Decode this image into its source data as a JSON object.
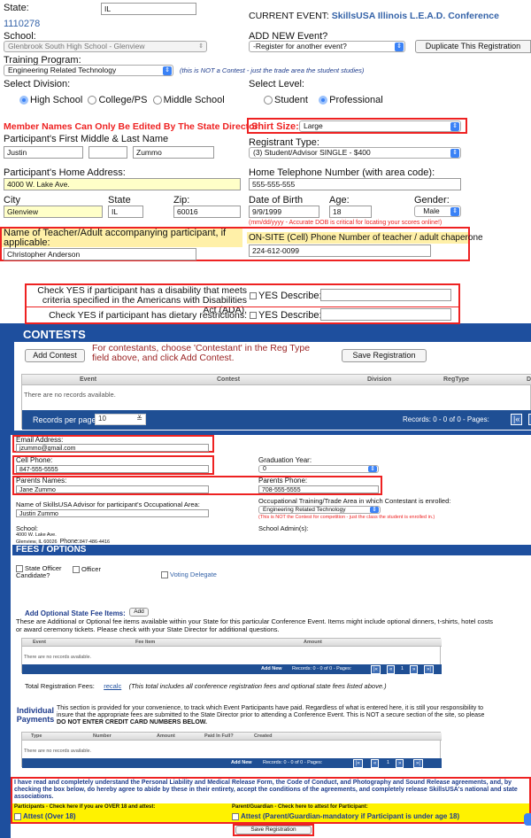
{
  "top": {
    "state_label": "State:",
    "state_value": "IL",
    "reg_id": "1110278",
    "current_event_prefix": "CURRENT EVENT:",
    "current_event_name": "SkillsUSA Illinois L.E.A.D. Conference",
    "school_label": "School:",
    "school_value": "Glenbrook South High School - Glenview",
    "add_event_label": "ADD NEW Event?",
    "add_event_value": "-Register for another event?",
    "duplicate_btn": "Duplicate This Registration",
    "program_label": "Training Program:",
    "program_value": "Engineering Related Technology",
    "program_note": "(this is NOT a Contest - just the trade area the student studies)",
    "division_label": "Select Division:",
    "divisions": [
      "High School",
      "College/PS",
      "Middle School"
    ],
    "level_label": "Select Level:",
    "levels": [
      "Student",
      "Professional"
    ]
  },
  "participant": {
    "names_warning": "Member Names Can Only Be Edited By The State Director",
    "shirt_label": "Shirt Size:",
    "shirt_value": "Large",
    "name_label": "Participant's First Middle & Last Name",
    "first_name": "Justin",
    "middle_name": "",
    "last_name": "Zummo",
    "reg_type_label": "Registrant Type:",
    "reg_type_value": "(3) Student/Advisor SINGLE - $400",
    "address_label": "Participant's Home Address:",
    "address_value": "4000 W. Lake Ave.",
    "phone_label": "Home Telephone Number (with area code):",
    "phone_value": "555-555-555",
    "city_label": "City",
    "city_value": "Glenview",
    "state_label": "State",
    "state_value": "IL",
    "zip_label": "Zip:",
    "zip_value": "60016",
    "dob_label": "Date of Birth",
    "dob_value": "9/9/1999",
    "age_label": "Age:",
    "age_value": "18",
    "gender_label": "Gender:",
    "gender_value": "Male",
    "dob_note": "(mm/dd/yyyy - Accurate DOB is critical for locating your scores online!)",
    "teacher_label": "Name of Teacher/Adult accompanying participant, if applicable:",
    "teacher_value": "Christopher Anderson",
    "onsite_label": "ON-SITE (Cell) Phone Number of teacher / adult chaperone",
    "onsite_value": "224-612-0099"
  },
  "ada": {
    "disability_label": "Check YES if participant has a disability that meets criteria specified in the Americans with Disabilities Act (ADA).",
    "diet_label": "Check YES if participant has dietary restrictions:",
    "yes_label": "YES",
    "describe_label": "Describe:"
  },
  "contests": {
    "title": "CONTESTS",
    "add_btn": "Add Contest",
    "instructions": "For contestants, choose 'Contestant' in the Reg Type field above, and click Add Contest.",
    "save_btn": "Save Registration",
    "columns": [
      "Event",
      "Contest",
      "Division",
      "RegType",
      "D"
    ],
    "empty": "There are no records available.",
    "per_page_label": "Records per page:",
    "per_page_value": "10",
    "records": "Records: 0 - 0 of 0 - Pages:"
  },
  "contact": {
    "email_label": "Email Address:",
    "email_value": "jzummo@gmail.com",
    "cell_label": "Cell Phone:",
    "cell_value": "847-555-5555",
    "grad_label": "Graduation Year:",
    "grad_value": "0",
    "parents_label": "Parents Names:",
    "parents_value": "Jane Zummo",
    "parents_phone_label": "Parents Phone:",
    "parents_phone_value": "708-555-5555",
    "advisor_label": "Name of SkillsUSA Advisor for participant's Occupational Area:",
    "advisor_value": "Justin Zummo",
    "occ_label": "Occupational Training/Trade Area in which Contestant is enrolled:",
    "occ_value": "Engineering Related Technology",
    "occ_note": "(This is NOT the Contest for competition - just the class the student is enrolled in.)",
    "school_label": "School:",
    "school_addr1": "4000 W. Lake Ave.",
    "school_addr2": "Glenview, IL 60026",
    "school_phone_label": "Phone:",
    "school_phone": "847-486-4416",
    "admin_label": "School Admin(s):"
  },
  "fees": {
    "title": "FEES / OPTIONS",
    "state_officer": "State Officer Candidate?",
    "officer": "Officer",
    "voting": "Voting Delegate",
    "optional_label": "Add Optional State Fee Items:",
    "add_btn": "Add",
    "optional_desc": "These are Additional or Optional fee items available within your State for this particular Conference Event. Items might include optional dinners, t-shirts, hotel costs or award ceremony tickets. Please check with your State Director for additional questions.",
    "columns": [
      "Event",
      "Fee Item",
      "Amount"
    ],
    "empty": "There are no records available.",
    "add_new": "Add New",
    "records": "Records: 0 - 0 of 0 - Pages:",
    "page_num": "1",
    "total_label": "Total Registration Fees:",
    "recalc": "recalc",
    "total_note": "(This total includes all conference registration fees and optional state fees listed above.)"
  },
  "payments": {
    "title": "Individual Payments",
    "desc_a": "This section is provided for your convenience, to track which Event Participants have paid. Regardless of what is entered here, it is still your responsibility to insure that the appropriate fees are submitted to the State Director prior to attending a Conference Event. This is NOT a secure section of the site, so please ",
    "desc_b": "DO NOT ENTER CREDIT CARD NUMBERS BELOW.",
    "columns": [
      "Type",
      "Number",
      "Amount",
      "Paid In Full?",
      "Created"
    ],
    "empty": "There are no records available.",
    "add_new": "Add New",
    "records": "Records: 0 - 0 of 0 - Pages:",
    "page_num": "1"
  },
  "attest": {
    "statement": "I have read and completely understand the Personal Liability and Medical Release Form, the Code of Conduct, and Photography and Sound Release agreements, and, by checking the box below, do hereby agree to abide by these in their entirety, accept the conditions of the agreements, and completely release SkillsUSA's national and state associations.",
    "over18_label": "Participants - Check here if you are OVER 18 and attest:",
    "over18_cb": "Attest (Over 18)",
    "guardian_label": "Parent/Guardian - Check here to attest for Participant:",
    "guardian_cb": "Attest (Parent/Guardian-mandatory if Participant is under age 18)",
    "save_btn": "Save Registration"
  },
  "colors": {
    "accent": "#1e4f9e",
    "warning_red": "#e22222",
    "highlight_yellow": "#ffffc8"
  }
}
